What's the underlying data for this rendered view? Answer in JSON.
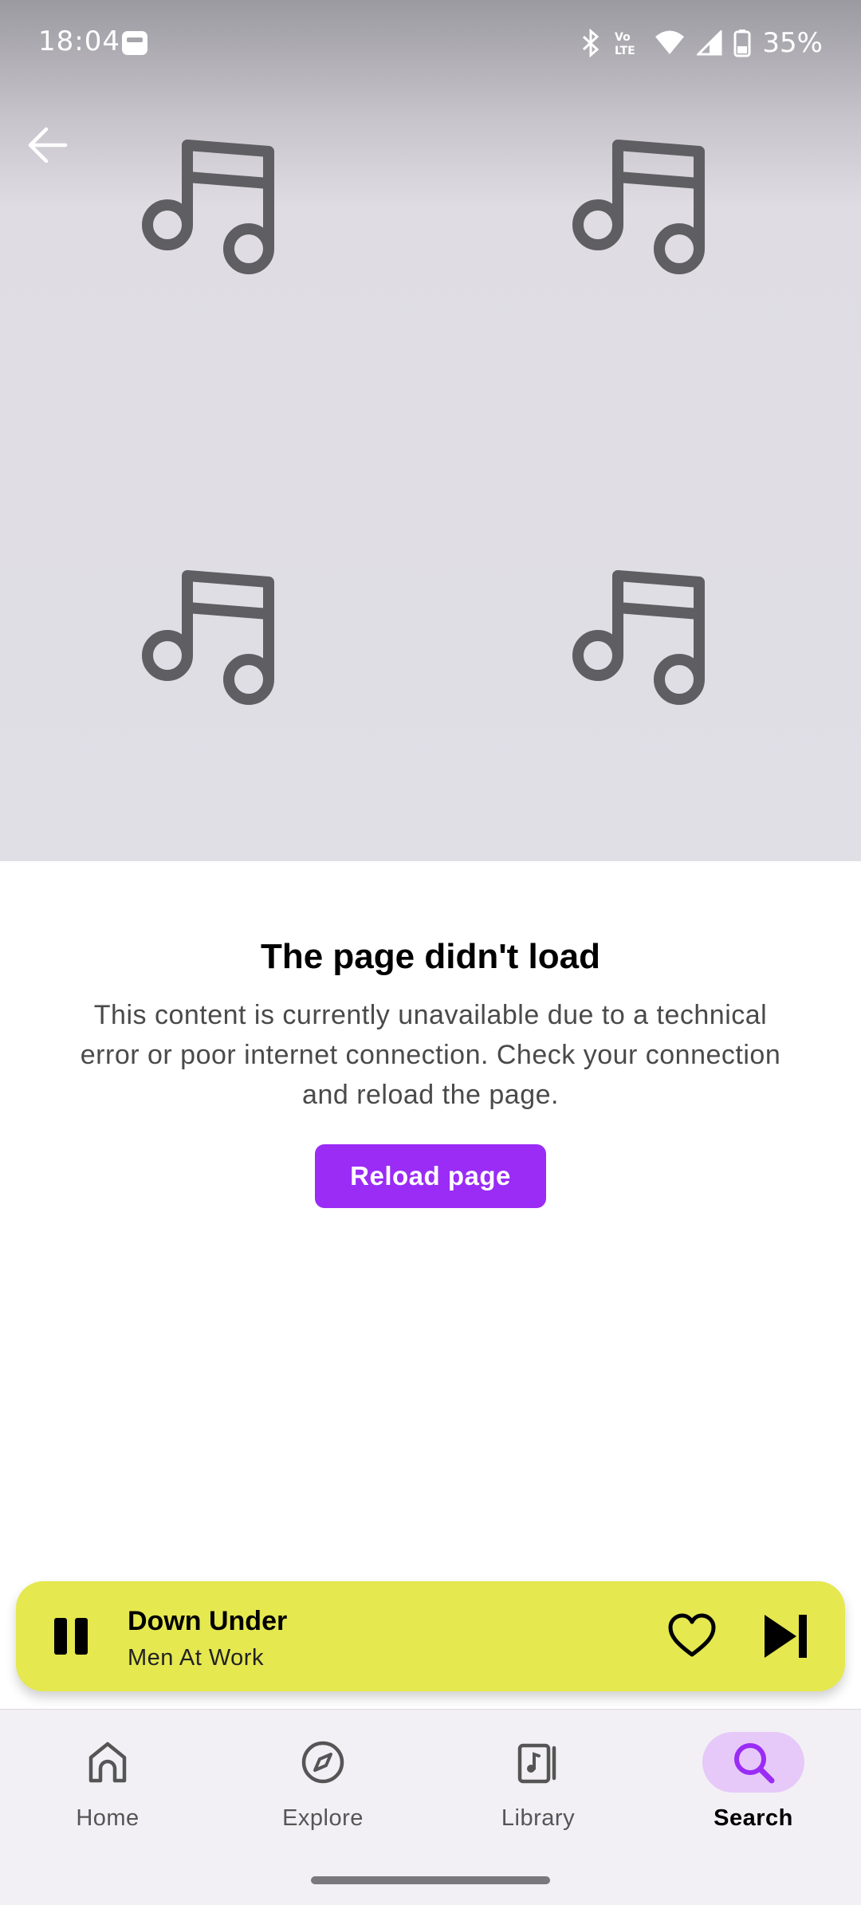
{
  "status_bar": {
    "time": "18:04",
    "battery": "35%"
  },
  "hero": {
    "placeholder_icon": "music-note-icon"
  },
  "error": {
    "title": "The page didn't load",
    "message": "This content is currently unavailable due to a technical error or poor internet connection. Check your connection and reload the page.",
    "reload_label": "Reload page"
  },
  "player": {
    "title": "Down Under",
    "artist": "Men At Work",
    "state": "playing"
  },
  "nav": {
    "items": [
      {
        "label": "Home",
        "icon": "home-icon",
        "active": false
      },
      {
        "label": "Explore",
        "icon": "compass-icon",
        "active": false
      },
      {
        "label": "Library",
        "icon": "library-icon",
        "active": false
      },
      {
        "label": "Search",
        "icon": "search-icon",
        "active": true
      }
    ]
  },
  "colors": {
    "accent": "#9a2cf5",
    "player_bg": "#e5e84f",
    "nav_active_bg": "#e6c9f8",
    "hero_bg": "#e1dfe6"
  }
}
